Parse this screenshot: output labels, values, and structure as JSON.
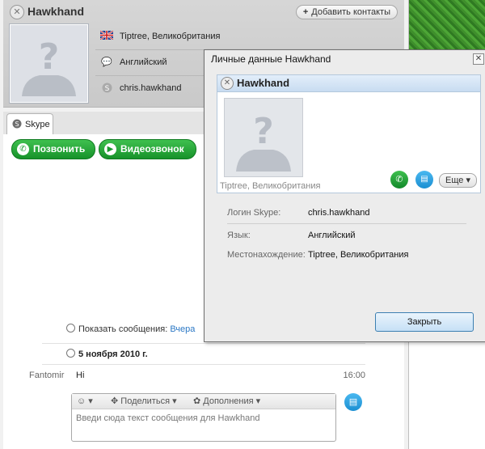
{
  "contact": {
    "name": "Hawkhand",
    "add_contacts_label": "Добавить контакты",
    "info": [
      {
        "icon": "uk-flag-icon",
        "text": "Tiptree, Великобритания"
      },
      {
        "icon": "language-icon",
        "text": "Английский"
      },
      {
        "icon": "skype-icon",
        "text": "chris.hawkhand"
      }
    ]
  },
  "tabs": {
    "skype_label": "Skype"
  },
  "actions": {
    "call_label": "Позвонить",
    "video_label": "Видеозвонок"
  },
  "history": {
    "show_messages_label": "Показать сообщения:",
    "show_messages_link": "Вчера",
    "date": "5 ноября 2010 г."
  },
  "message": {
    "sender": "Fantomir",
    "text": "Hi",
    "time": "16:00"
  },
  "compose": {
    "share_label": "Поделиться",
    "extras_label": "Дополнения",
    "placeholder": "Введи сюда текст сообщения для Hawkhand"
  },
  "dialog": {
    "title": "Личные данные Hawkhand",
    "card_name": "Hawkhand",
    "card_location": "Tiptree, Великобритания",
    "more_label": "Еще",
    "fields": [
      {
        "key": "Логин Skype:",
        "value": "chris.hawkhand"
      },
      {
        "key": "Язык:",
        "value": "Английский"
      },
      {
        "key": "Местонахождение:",
        "value": "Tiptree, Великобритания"
      }
    ],
    "close_label": "Закрыть"
  },
  "colors": {
    "call_green": "#17922a",
    "chat_blue": "#1b8fd2",
    "link_blue": "#2b78c5"
  }
}
